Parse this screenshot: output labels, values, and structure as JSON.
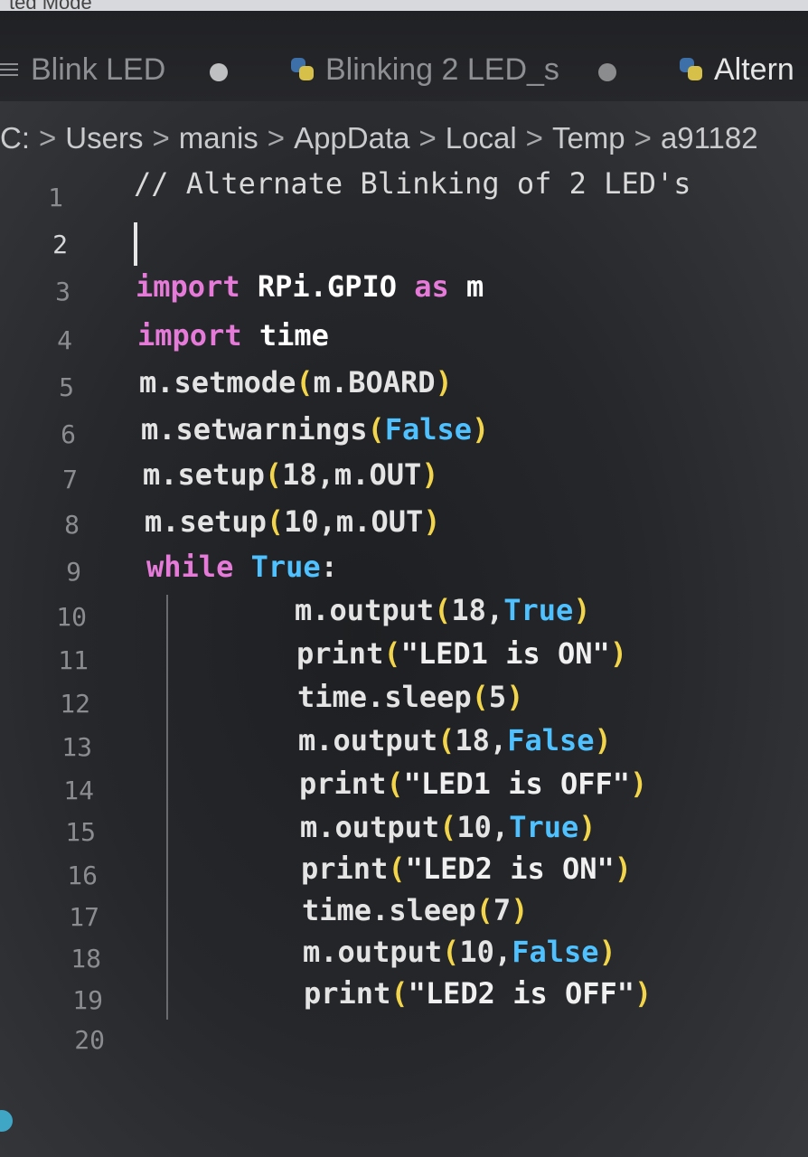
{
  "window": {
    "partial_title": "ted Mode"
  },
  "tabs": [
    {
      "label": "Blink LED",
      "icon": "menu-lines-icon",
      "active": false,
      "modified": true
    },
    {
      "label": "Blinking 2 LED_s",
      "icon": "python-icon",
      "active": false,
      "modified": true
    },
    {
      "label": "Altern",
      "icon": "python-icon",
      "active": true,
      "modified": false
    }
  ],
  "breadcrumb": [
    "C:",
    "Users",
    "manis",
    "AppData",
    "Local",
    "Temp",
    "a91182"
  ],
  "editor": {
    "lines": [
      {
        "num": "1"
      },
      {
        "num": "2"
      },
      {
        "num": "3"
      },
      {
        "num": "4"
      },
      {
        "num": "5"
      },
      {
        "num": "6"
      },
      {
        "num": "7"
      },
      {
        "num": "8"
      },
      {
        "num": "9"
      },
      {
        "num": "10"
      },
      {
        "num": "11"
      },
      {
        "num": "12"
      },
      {
        "num": "13"
      },
      {
        "num": "14"
      },
      {
        "num": "15"
      },
      {
        "num": "16"
      },
      {
        "num": "17"
      },
      {
        "num": "18"
      },
      {
        "num": "19"
      },
      {
        "num": "20"
      }
    ],
    "code": {
      "l1": {
        "comment": "// Alternate Blinking of 2 LED's"
      },
      "l3": {
        "kw": "import",
        "mod": " RPi.GPIO ",
        "kw2": "as",
        "alias": " m"
      },
      "l4": {
        "kw": "import",
        "mod": " time"
      },
      "l5": {
        "fn": "m.setmode",
        "op": "(",
        "arg": "m.BOARD",
        "cp": ")"
      },
      "l6": {
        "fn": "m.setwarnings",
        "op": "(",
        "arg": "False",
        "cp": ")"
      },
      "l7": {
        "fn": "m.setup",
        "op": "(",
        "arg": "18,m.OUT",
        "cp": ")"
      },
      "l8": {
        "fn": "m.setup",
        "op": "(",
        "arg": "10,m.OUT",
        "cp": ")"
      },
      "l9": {
        "kw": "while",
        "val": " True",
        "colon": ":"
      },
      "l10": {
        "fn": "m.output",
        "op": "(",
        "a1": "18,",
        "a2": "True",
        "cp": ")"
      },
      "l11": {
        "fn": "print",
        "op": "(",
        "str": "\"LED1 is ON\"",
        "cp": ")"
      },
      "l12": {
        "fn": "time.sleep",
        "op": "(",
        "arg": "5",
        "cp": ")"
      },
      "l13": {
        "fn": "m.output",
        "op": "(",
        "a1": "18,",
        "a2": "False",
        "cp": ")"
      },
      "l14": {
        "fn": "print",
        "op": "(",
        "str": "\"LED1 is OFF\"",
        "cp": ")"
      },
      "l15": {
        "fn": "m.output",
        "op": "(",
        "a1": "10,",
        "a2": "True",
        "cp": ")"
      },
      "l16": {
        "fn": "print",
        "op": "(",
        "str": "\"LED2 is ON\"",
        "cp": ")"
      },
      "l17": {
        "fn": "time.sleep",
        "op": "(",
        "arg": "7",
        "cp": ")"
      },
      "l18": {
        "fn": "m.output",
        "op": "(",
        "a1": "10,",
        "a2": "False",
        "cp": ")"
      },
      "l19": {
        "fn": "print",
        "op": "(",
        "str": "\"LED2 is OFF\"",
        "cp": ")"
      }
    }
  },
  "colors": {
    "keyword": "#e57ad8",
    "boolean": "#4fc1ff",
    "bracket": "#f2d54b",
    "text": "#e4e4e4"
  }
}
